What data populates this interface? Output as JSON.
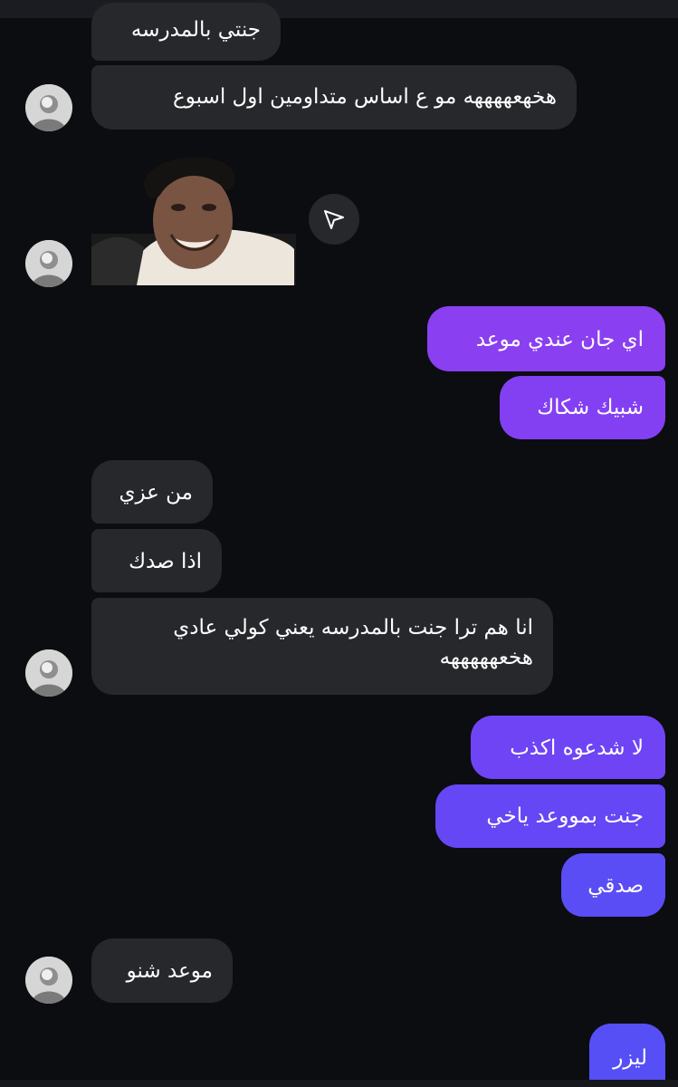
{
  "chat": {
    "messages": [
      {
        "sender": "them",
        "text": "جنتي بالمدرسه"
      },
      {
        "sender": "them",
        "text": "هخهعههههه مو ع اساس متداومين اول اسبوع"
      },
      {
        "sender": "them",
        "type": "sticker",
        "icon": "sticker-image"
      },
      {
        "sender": "me",
        "text": "اي جان عندي موعد"
      },
      {
        "sender": "me",
        "text": "شبيك شكاك"
      },
      {
        "sender": "them",
        "text": "من عزي"
      },
      {
        "sender": "them",
        "text": "اذا صدك"
      },
      {
        "sender": "them",
        "text_lines": [
          "انا هم ترا جنت بالمدرسه يعني كولي عادي",
          "هخعهههههه"
        ]
      },
      {
        "sender": "me",
        "text": "لا شدعوه اكذب"
      },
      {
        "sender": "me",
        "text": "جنت بمووعد ياخي"
      },
      {
        "sender": "me",
        "text": "صدقي"
      },
      {
        "sender": "them",
        "text": "موعد شنو"
      },
      {
        "sender": "me",
        "text": "ليزر"
      }
    ]
  },
  "share_button": {
    "icon": "send-icon"
  },
  "colors": {
    "background": "#0b0d11",
    "incoming_bubble": "#26282c",
    "outgoing_top": "#8a3ff0",
    "outgoing_bottom": "#5b4df5",
    "text": "#ffffff"
  }
}
